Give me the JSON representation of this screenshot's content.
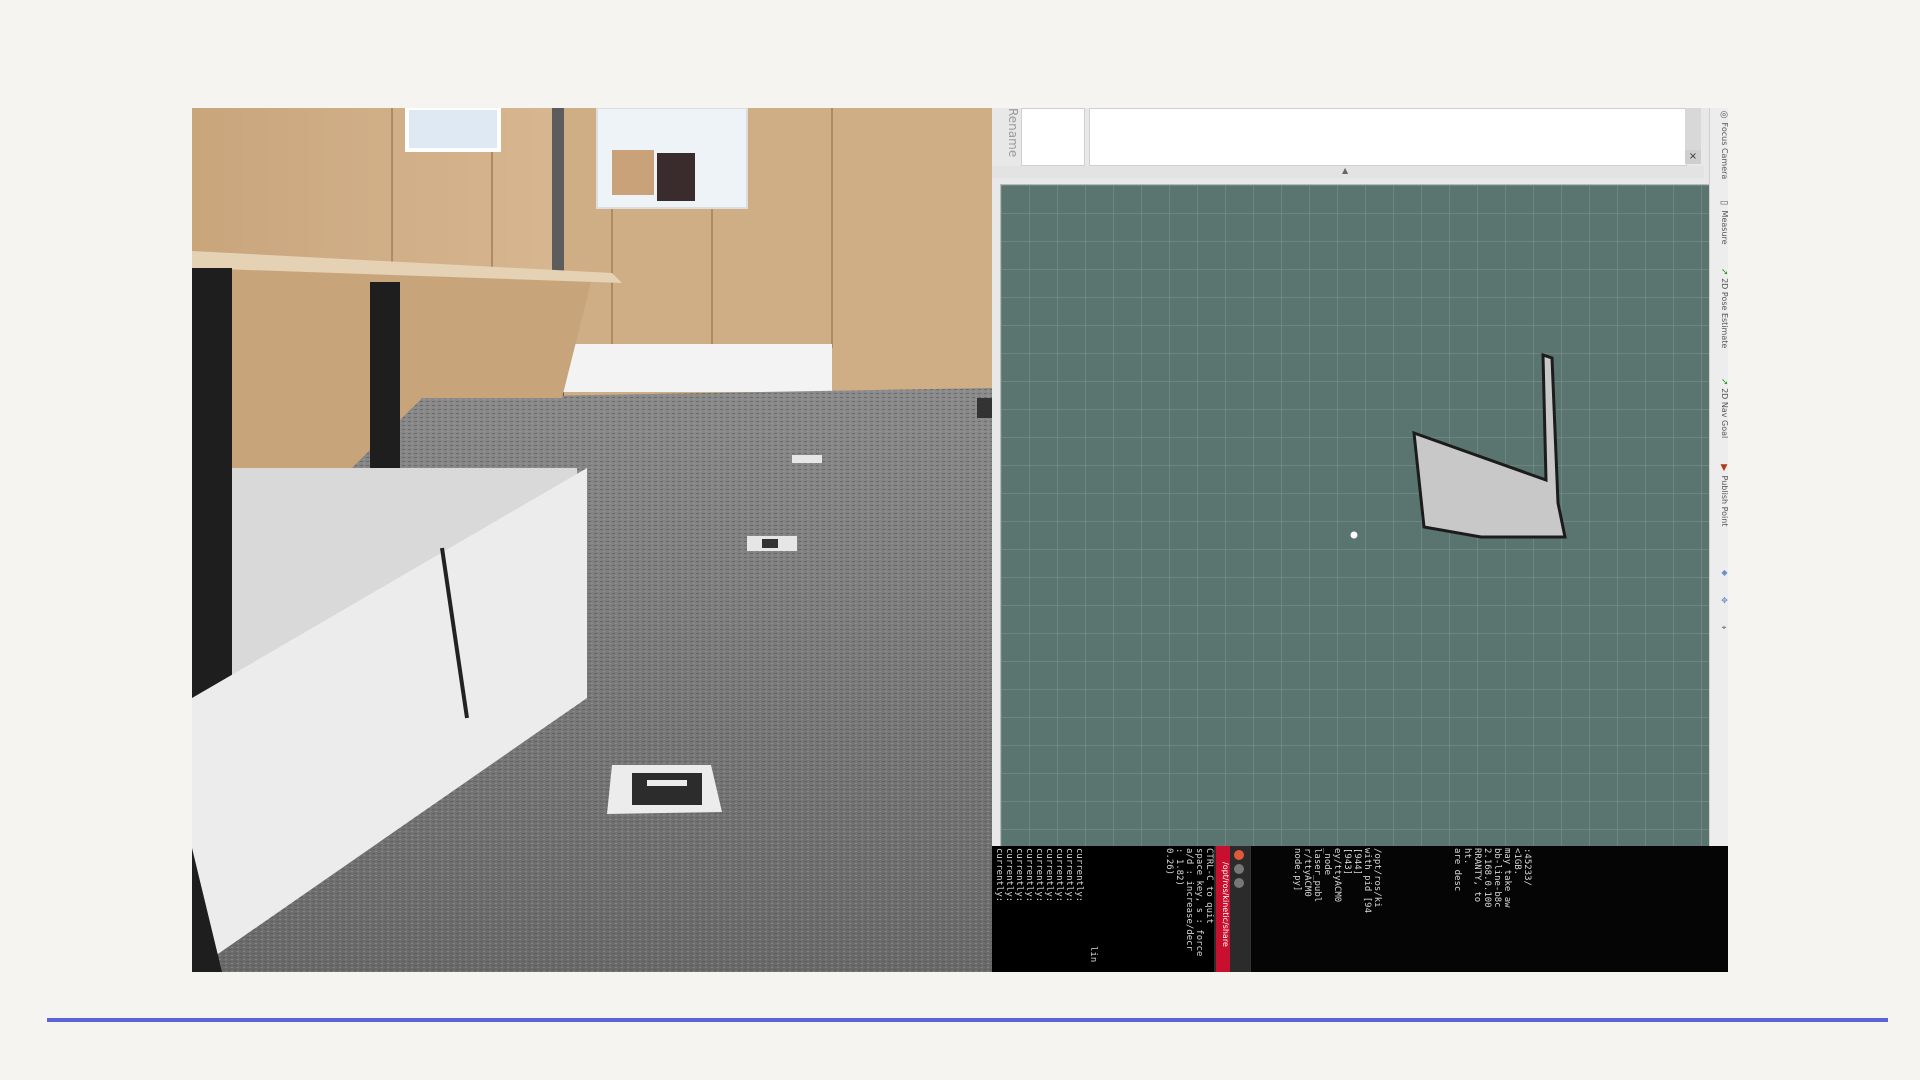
{
  "colors": {
    "page_background": "#f5f4f1",
    "accent_rule": "#5b63d8",
    "map_grid_background": "#5a7470",
    "terminal_red": "#c8102e"
  },
  "rviz": {
    "rename_tab": "Rename",
    "close_icon": "×",
    "tools": [
      {
        "icon": "camera-icon",
        "label": "Focus Camera"
      },
      {
        "icon": "ruler-icon",
        "label": "Measure"
      },
      {
        "icon": "green-arrow-icon",
        "label": "2D Pose Estimate"
      },
      {
        "icon": "green-arrow-icon",
        "label": "2D Nav Goal"
      },
      {
        "icon": "pin-icon",
        "label": "Publish Point"
      }
    ]
  },
  "terminal": {
    "title_path": "/opt/ros/kinetic/share",
    "left_column_lines": [
      "currently:",
      "currently:",
      "currently:",
      "currently:",
      "currently:",
      "currently:",
      "currently:",
      "currently:",
      "currently:"
    ],
    "trailing_fragment": "lin",
    "help_lines": [
      "CTRL-C to quit",
      "",
      "space key, s : force",
      "",
      "a/d : increase/decr",
      ": 1.82)",
      "0.26)"
    ],
    "log_lines": [
      "/opt/ros/ki",
      "with pid [94",
      "[944]",
      "[943]",
      "",
      "ey/ttyACM0",
      "_node",
      "laser_publ",
      "r/ttyACM0",
      "node.py]"
    ],
    "right_lines": [
      ":45233/",
      "",
      "<1GB.",
      "",
      "may take aw",
      "bb-line-b8c",
      "2.168.0.100",
      "",
      "RRANTY, to",
      "ht.",
      "are desc"
    ]
  }
}
